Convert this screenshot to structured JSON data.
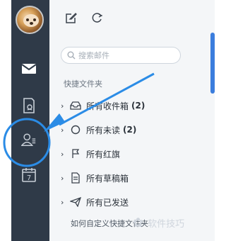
{
  "sidebar": {
    "icons": [
      "mail-icon",
      "notes-icon",
      "contacts-icon",
      "calendar-icon"
    ],
    "calendar_day": "7"
  },
  "toolbar": {
    "compose_icon": "edit-icon",
    "refresh_icon": "refresh-icon"
  },
  "search": {
    "placeholder": "搜索邮件"
  },
  "folders": {
    "title": "快捷文件夹",
    "items": [
      {
        "label": "所有收件箱",
        "count": "(2)",
        "icon": "inbox-icon"
      },
      {
        "label": "所有未读",
        "count": "(2)",
        "icon": "unread-icon"
      },
      {
        "label": "所有红旗",
        "count": "",
        "icon": "flag-icon"
      },
      {
        "label": "所有草稿箱",
        "count": "",
        "icon": "draft-icon"
      },
      {
        "label": "所有已发送",
        "count": "",
        "icon": "sent-icon"
      }
    ],
    "hint": "如何自定义快捷文件夹"
  },
  "watermark": {
    "text": "软件技巧"
  },
  "colors": {
    "rail": "#2f3a48",
    "panel": "#f4f6f8",
    "accent": "#3b7ddd",
    "annotation": "#2b8ce6"
  }
}
